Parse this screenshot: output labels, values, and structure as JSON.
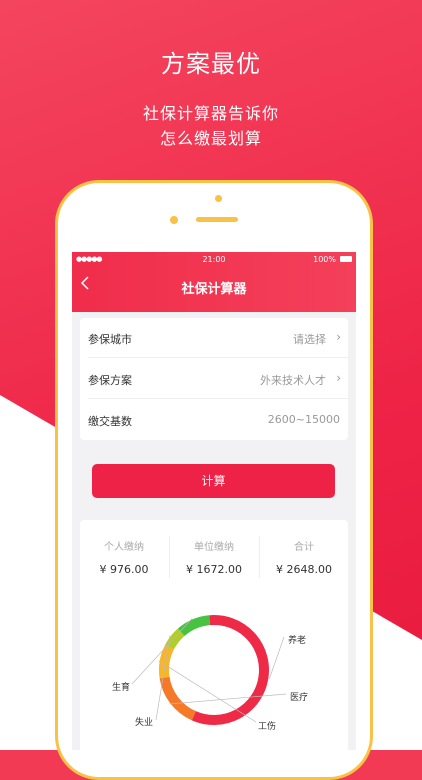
{
  "promo": {
    "title": "方案最优",
    "line1": "社保计算器告诉你",
    "line2": "怎么缴最划算"
  },
  "status_bar": {
    "signal": "●●●●● ",
    "time": "21:00",
    "battery": "100%"
  },
  "nav": {
    "title": "社保计算器"
  },
  "form": {
    "rows": [
      {
        "label": "参保城市",
        "value": "请选择"
      },
      {
        "label": "参保方案",
        "value": "外来技术人才"
      },
      {
        "label": "缴交基数",
        "value": "2600~15000"
      }
    ]
  },
  "calc_button": "计算",
  "summary": [
    {
      "label": "个人缴纳",
      "value": "¥ 976.00"
    },
    {
      "label": "单位缴纳",
      "value": "¥ 1672.00"
    },
    {
      "label": "合计",
      "value": "¥ 2648.00"
    }
  ],
  "chart_data": {
    "type": "pie",
    "labels": [
      "养老",
      "医疗",
      "工伤",
      "失业",
      "生育"
    ],
    "colors": [
      "#ee2a46",
      "#f47a2a",
      "#f7b52a",
      "#b2cc2a",
      "#48c241"
    ],
    "values": [
      58,
      16,
      10,
      6,
      10
    ]
  }
}
